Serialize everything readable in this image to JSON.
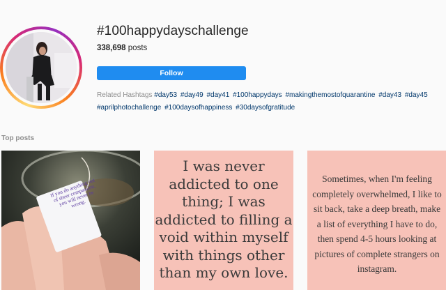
{
  "header": {
    "hashtag": "#100happydayschallenge",
    "post_count": "338,698",
    "post_label": "posts",
    "follow_label": "Follow"
  },
  "related": {
    "label": "Related Hashtags",
    "tags": [
      "#day53",
      "#day49",
      "#day41",
      "#100happydays",
      "#makingthemostofquarantine",
      "#day43",
      "#day45",
      "#aprilphotochallenge",
      "#100daysofhappiness",
      "#30daysofgratitude"
    ]
  },
  "section": {
    "top_posts": "Top posts"
  },
  "posts": [
    {
      "tag_text": "If you do anything out of sheer compassion, you will never be wrong."
    },
    {
      "quote": "I was never addicted to one thing; I was addicted to filling a void within myself with things other than my own love."
    },
    {
      "quote": "Sometimes, when I'm feeling completely overwhelmed, I like to sit back, take a deep breath, make a list of everything I have to do, then spend 4-5 hours looking at pictures of complete strangers on instagram."
    }
  ],
  "colors": {
    "accent": "#1f8cf0",
    "tile_pink": "#f7c2b8",
    "tag_link": "#00376b"
  }
}
